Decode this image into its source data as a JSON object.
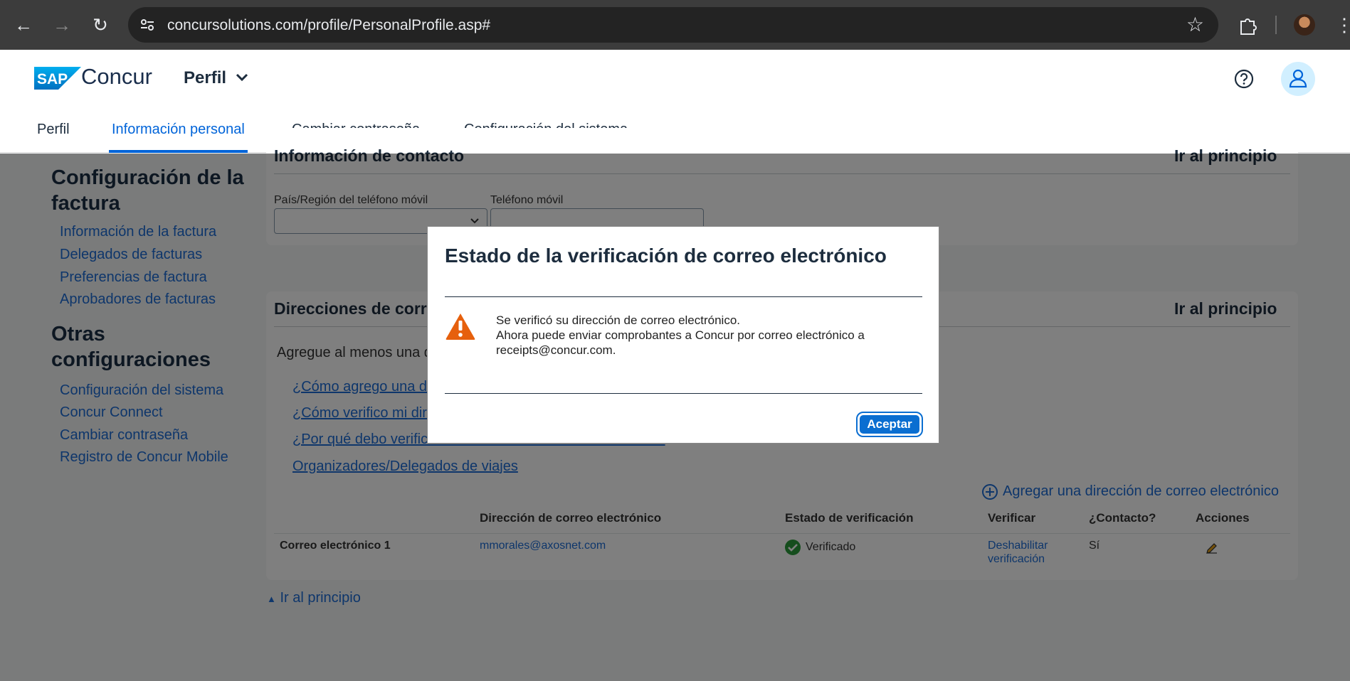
{
  "browser": {
    "url": "concursolutions.com/profile/PersonalProfile.asp#"
  },
  "app": {
    "brand_logo": "SAP",
    "brand_name": "Concur",
    "module": "Perfil",
    "tabs": [
      {
        "label": "Perfil"
      },
      {
        "label": "Información personal"
      },
      {
        "label": "Cambiar contraseña"
      },
      {
        "label": "Configuración del sistema"
      }
    ]
  },
  "sidebar": {
    "section1_title": "Configuración de la factura",
    "section1_items": [
      {
        "label": "Información de la factura"
      },
      {
        "label": "Delegados de facturas"
      },
      {
        "label": "Preferencias de factura"
      },
      {
        "label": "Aprobadores de facturas"
      }
    ],
    "section2_title": "Otras configuraciones",
    "section2_items": [
      {
        "label": "Configuración del sistema"
      },
      {
        "label": "Concur Connect"
      },
      {
        "label": "Cambiar contraseña"
      },
      {
        "label": "Registro de Concur Mobile"
      }
    ]
  },
  "contact": {
    "title": "Información de contacto",
    "top_link": "Ir al principio",
    "country_label": "País/Región del teléfono móvil",
    "phone_label": "Teléfono móvil"
  },
  "emails": {
    "title": "Direcciones de correo electrónico",
    "top_link": "Ir al principio",
    "intro": "Agregue al menos una dirección de correo electrónico.",
    "help_links": [
      {
        "label": "¿Cómo agrego una dirección de correo electrónico?"
      },
      {
        "label": "¿Cómo verifico mi dirección de correo electrónico?"
      },
      {
        "label": "¿Por qué debo verificar mi dirección de correo electrónico?"
      },
      {
        "label": "Organizadores/Delegados de viajes"
      }
    ],
    "add_label": "Agregar una dirección de correo electrónico",
    "columns": {
      "address": "Dirección de correo electrónico",
      "status": "Estado de verificación",
      "verify": "Verificar",
      "contact": "¿Contacto?",
      "actions": "Acciones"
    },
    "rows": [
      {
        "name": "Correo electrónico 1",
        "address": "mmorales@axosnet.com",
        "status": "Verificado",
        "verify_line1": "Deshabilitar",
        "verify_line2": "verificación",
        "contact": "Sí"
      }
    ]
  },
  "back_to_top": "Ir al principio",
  "modal": {
    "title": "Estado de la verificación de correo electrónico",
    "line1": "Se verificó su dirección de correo electrónico.",
    "line2": "Ahora puede enviar comprobantes a Concur por correo electrónico a",
    "line3": "receipts@concur.com.",
    "ok_label": "Aceptar"
  }
}
